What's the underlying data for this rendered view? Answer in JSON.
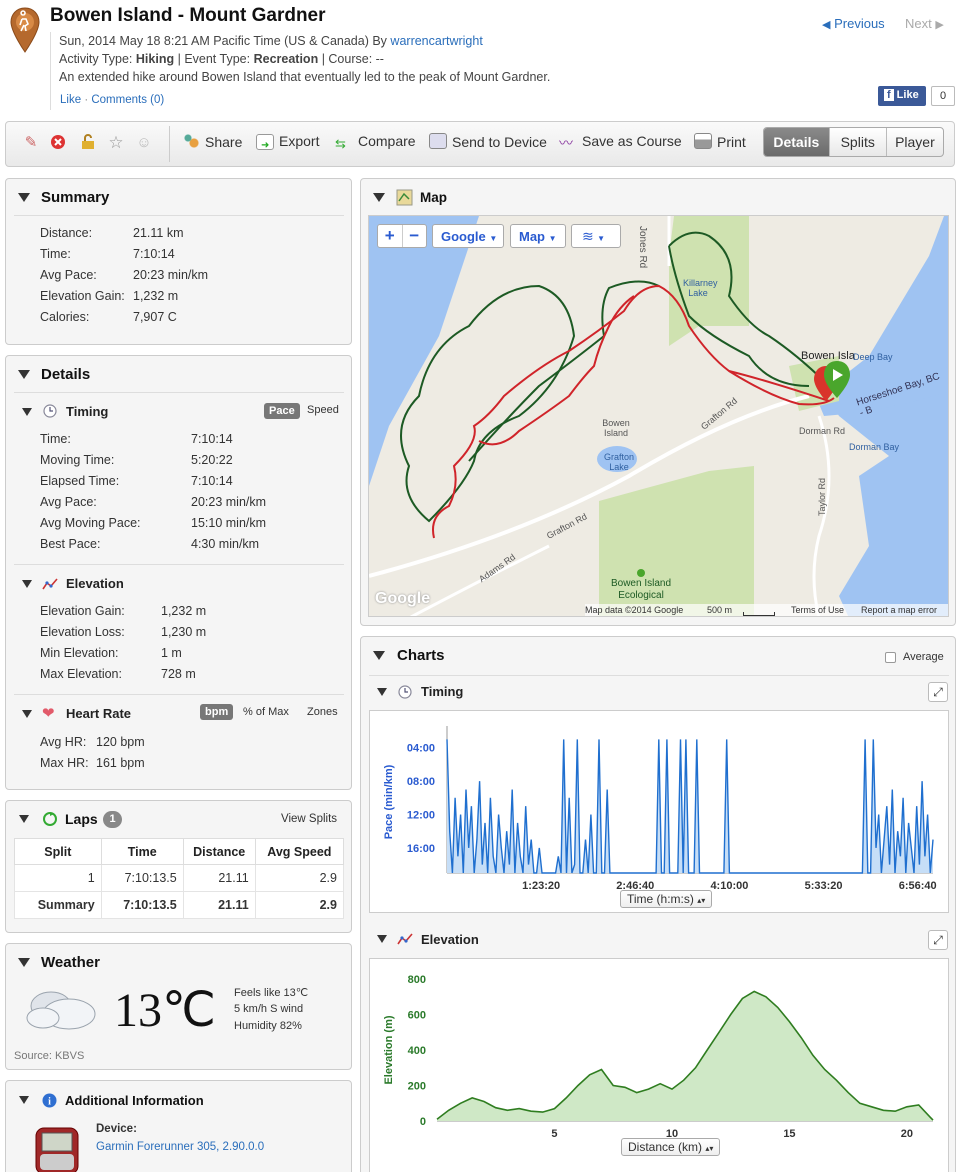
{
  "header": {
    "title": "Bowen Island - Mount Gardner",
    "date": "Sun, 2014 May 18 8:21 AM Pacific Time (US & Canada) By",
    "author": "warrencartwright",
    "activity_label": "Activity Type:",
    "activity_value": "Hiking",
    "event_label": "| Event Type:",
    "event_value": "Recreation",
    "course": "| Course: --",
    "description": "An extended hike around Bowen Island that eventually led to the peak of Mount Gardner.",
    "like": "Like",
    "sep": "·",
    "comments": "Comments (0)",
    "prev": "Previous",
    "next": "Next",
    "fb_like": "Like",
    "fb_count": "0"
  },
  "toolbar": {
    "share": "Share",
    "export": "Export",
    "compare": "Compare",
    "send": "Send to Device",
    "save_course": "Save as Course",
    "print": "Print",
    "tabs": [
      "Details",
      "Splits",
      "Player"
    ]
  },
  "summary": {
    "title": "Summary",
    "rows": [
      {
        "label": "Distance:",
        "value": "21.11 km"
      },
      {
        "label": "Time:",
        "value": "7:10:14"
      },
      {
        "label": "Avg Pace:",
        "value": "20:23 min/km"
      },
      {
        "label": "Elevation Gain:",
        "value": "1,232 m"
      },
      {
        "label": "Calories:",
        "value": "7,907 C"
      }
    ]
  },
  "details": {
    "title": "Details",
    "timing": {
      "title": "Timing",
      "toggle_on": "Pace",
      "toggle_off": "Speed",
      "rows": [
        {
          "label": "Time:",
          "value": "7:10:14"
        },
        {
          "label": "Moving Time:",
          "value": "5:20:22"
        },
        {
          "label": "Elapsed Time:",
          "value": "7:10:14"
        },
        {
          "label": "Avg Pace:",
          "value": "20:23 min/km"
        },
        {
          "label": "Avg Moving Pace:",
          "value": "15:10 min/km"
        },
        {
          "label": "Best Pace:",
          "value": "4:30 min/km"
        }
      ]
    },
    "elevation": {
      "title": "Elevation",
      "rows": [
        {
          "label": "Elevation Gain:",
          "value": "1,232 m"
        },
        {
          "label": "Elevation Loss:",
          "value": "1,230 m"
        },
        {
          "label": "Min Elevation:",
          "value": "1 m"
        },
        {
          "label": "Max Elevation:",
          "value": "728 m"
        }
      ]
    },
    "heart_rate": {
      "title": "Heart Rate",
      "toggle_on": "bpm",
      "toggle_mid": "% of Max",
      "toggle_off": "Zones",
      "rows": [
        {
          "label": "Avg HR:",
          "value": "120 bpm"
        },
        {
          "label": "Max HR:",
          "value": "161 bpm"
        }
      ]
    }
  },
  "laps": {
    "title": "Laps",
    "count": "1",
    "view_splits": "View Splits",
    "columns": [
      "Split",
      "Time",
      "Distance",
      "Avg Speed"
    ],
    "rows": [
      [
        "1",
        "7:10:13.5",
        "21.11",
        "2.9"
      ],
      [
        "Summary",
        "7:10:13.5",
        "21.11",
        "2.9"
      ]
    ]
  },
  "weather": {
    "title": "Weather",
    "temp": "13℃",
    "feels": "Feels like 13℃",
    "wind": "5 km/h S wind",
    "humidity": "Humidity 82%",
    "source": "Source: KBVS"
  },
  "additional": {
    "title": "Additional Information",
    "device_label": "Device:",
    "device_value": "Garmin Forerunner 305, 2.90.0.0"
  },
  "map": {
    "title": "Map",
    "provider": "Google",
    "type": "Map",
    "labels": {
      "jones": "Jones Rd",
      "killarney": "Killarney Lake",
      "bowen_island_town": "Bowen Isla",
      "deep_bay": "Deep Bay",
      "horseshoe": "Horseshoe Bay, BC - B",
      "bowen_island": "Bowen Island",
      "grafton_lake": "Grafton Lake",
      "grafton_rd": "Grafton Rd",
      "grafton_rd2": "Grafton Rd",
      "dorman_rd": "Dorman Rd",
      "dorman_bay": "Dorman Bay",
      "taylor_rd": "Taylor Rd",
      "adams_rd": "Adams Rd",
      "ecological": "Bowen Island Ecological",
      "google": "Google"
    },
    "attribution": "Map data ©2014 Google",
    "scale": "500 m",
    "terms": "Terms of Use",
    "report": "Report a map error"
  },
  "charts": {
    "title": "Charts",
    "average": "Average",
    "timing": {
      "title": "Timing",
      "select": "Time (h:m:s)"
    },
    "elevation": {
      "title": "Elevation",
      "select": "Distance (km)"
    }
  },
  "chart_data": [
    {
      "type": "area",
      "title": "Timing",
      "ylabel": "Pace (min/km)",
      "xlabel": "Time (h:m:s)",
      "y_ticks": [
        "04:00",
        "08:00",
        "12:00",
        "16:00"
      ],
      "x_ticks": [
        "1:23:20",
        "2:46:40",
        "4:10:00",
        "5:33:20",
        "6:56:40"
      ],
      "ylim": [
        2,
        19
      ],
      "xlim_seconds": [
        0,
        25814
      ],
      "series": [
        {
          "values_min_per_km": [
            3,
            14,
            19,
            10,
            17,
            12,
            19,
            9,
            16,
            11,
            19,
            15,
            8,
            18,
            13,
            19,
            10,
            17,
            19,
            12,
            16,
            19,
            14,
            18,
            9,
            19,
            13,
            17,
            19,
            11,
            18,
            15,
            19,
            19,
            16,
            19,
            19,
            19,
            19,
            19,
            19,
            17,
            19,
            3,
            19,
            10,
            19,
            18,
            3,
            19,
            19,
            15,
            19,
            12,
            19,
            19,
            3,
            19,
            19,
            9,
            19,
            19,
            19,
            19,
            19,
            19,
            19,
            19,
            19,
            19,
            19,
            19,
            19,
            19,
            19,
            19,
            19,
            19,
            3,
            19,
            19,
            3,
            19,
            19,
            19,
            19,
            3,
            19,
            3,
            19,
            19,
            19,
            3,
            19,
            19,
            19,
            19,
            19,
            19,
            19,
            19,
            19,
            19,
            3,
            19,
            19,
            19,
            19,
            19,
            19,
            19,
            19,
            19,
            19,
            19,
            19,
            19,
            19,
            19,
            19,
            19,
            19,
            19,
            19,
            19,
            19,
            19,
            19,
            19,
            19,
            19,
            19,
            19,
            19,
            19,
            19,
            19,
            19,
            19,
            19,
            19,
            19,
            19,
            19,
            19,
            19,
            19,
            19,
            19,
            19,
            19,
            19,
            19,
            19,
            3,
            19,
            19,
            3,
            16,
            12,
            19,
            15,
            11,
            18,
            9,
            19,
            14,
            17,
            10,
            19,
            13,
            16,
            19,
            11,
            18,
            8,
            17,
            12,
            19,
            15
          ]
        }
      ]
    },
    {
      "type": "area",
      "title": "Elevation",
      "ylabel": "Elevation (m)",
      "xlabel": "Distance (km)",
      "ylim": [
        0,
        800
      ],
      "xlim": [
        0,
        21.11
      ],
      "x_ticks": [
        5,
        10,
        15,
        20
      ],
      "y_ticks": [
        0,
        200,
        400,
        600,
        800
      ],
      "x": [
        0,
        0.5,
        1,
        1.5,
        2,
        2.5,
        3,
        3.5,
        4,
        4.5,
        5,
        5.5,
        6,
        6.5,
        7,
        7.5,
        8,
        8.5,
        9,
        9.5,
        10,
        10.5,
        11,
        11.5,
        12,
        12.5,
        13,
        13.5,
        14,
        14.5,
        15,
        15.5,
        16,
        16.5,
        17,
        17.5,
        18,
        18.5,
        19,
        19.5,
        20,
        20.5,
        21,
        21.11
      ],
      "y": [
        10,
        60,
        100,
        130,
        110,
        75,
        60,
        70,
        55,
        50,
        70,
        130,
        200,
        260,
        290,
        200,
        190,
        160,
        180,
        210,
        180,
        230,
        300,
        400,
        500,
        600,
        690,
        730,
        700,
        640,
        560,
        470,
        370,
        290,
        230,
        160,
        100,
        80,
        60,
        55,
        80,
        90,
        20,
        5
      ]
    }
  ]
}
